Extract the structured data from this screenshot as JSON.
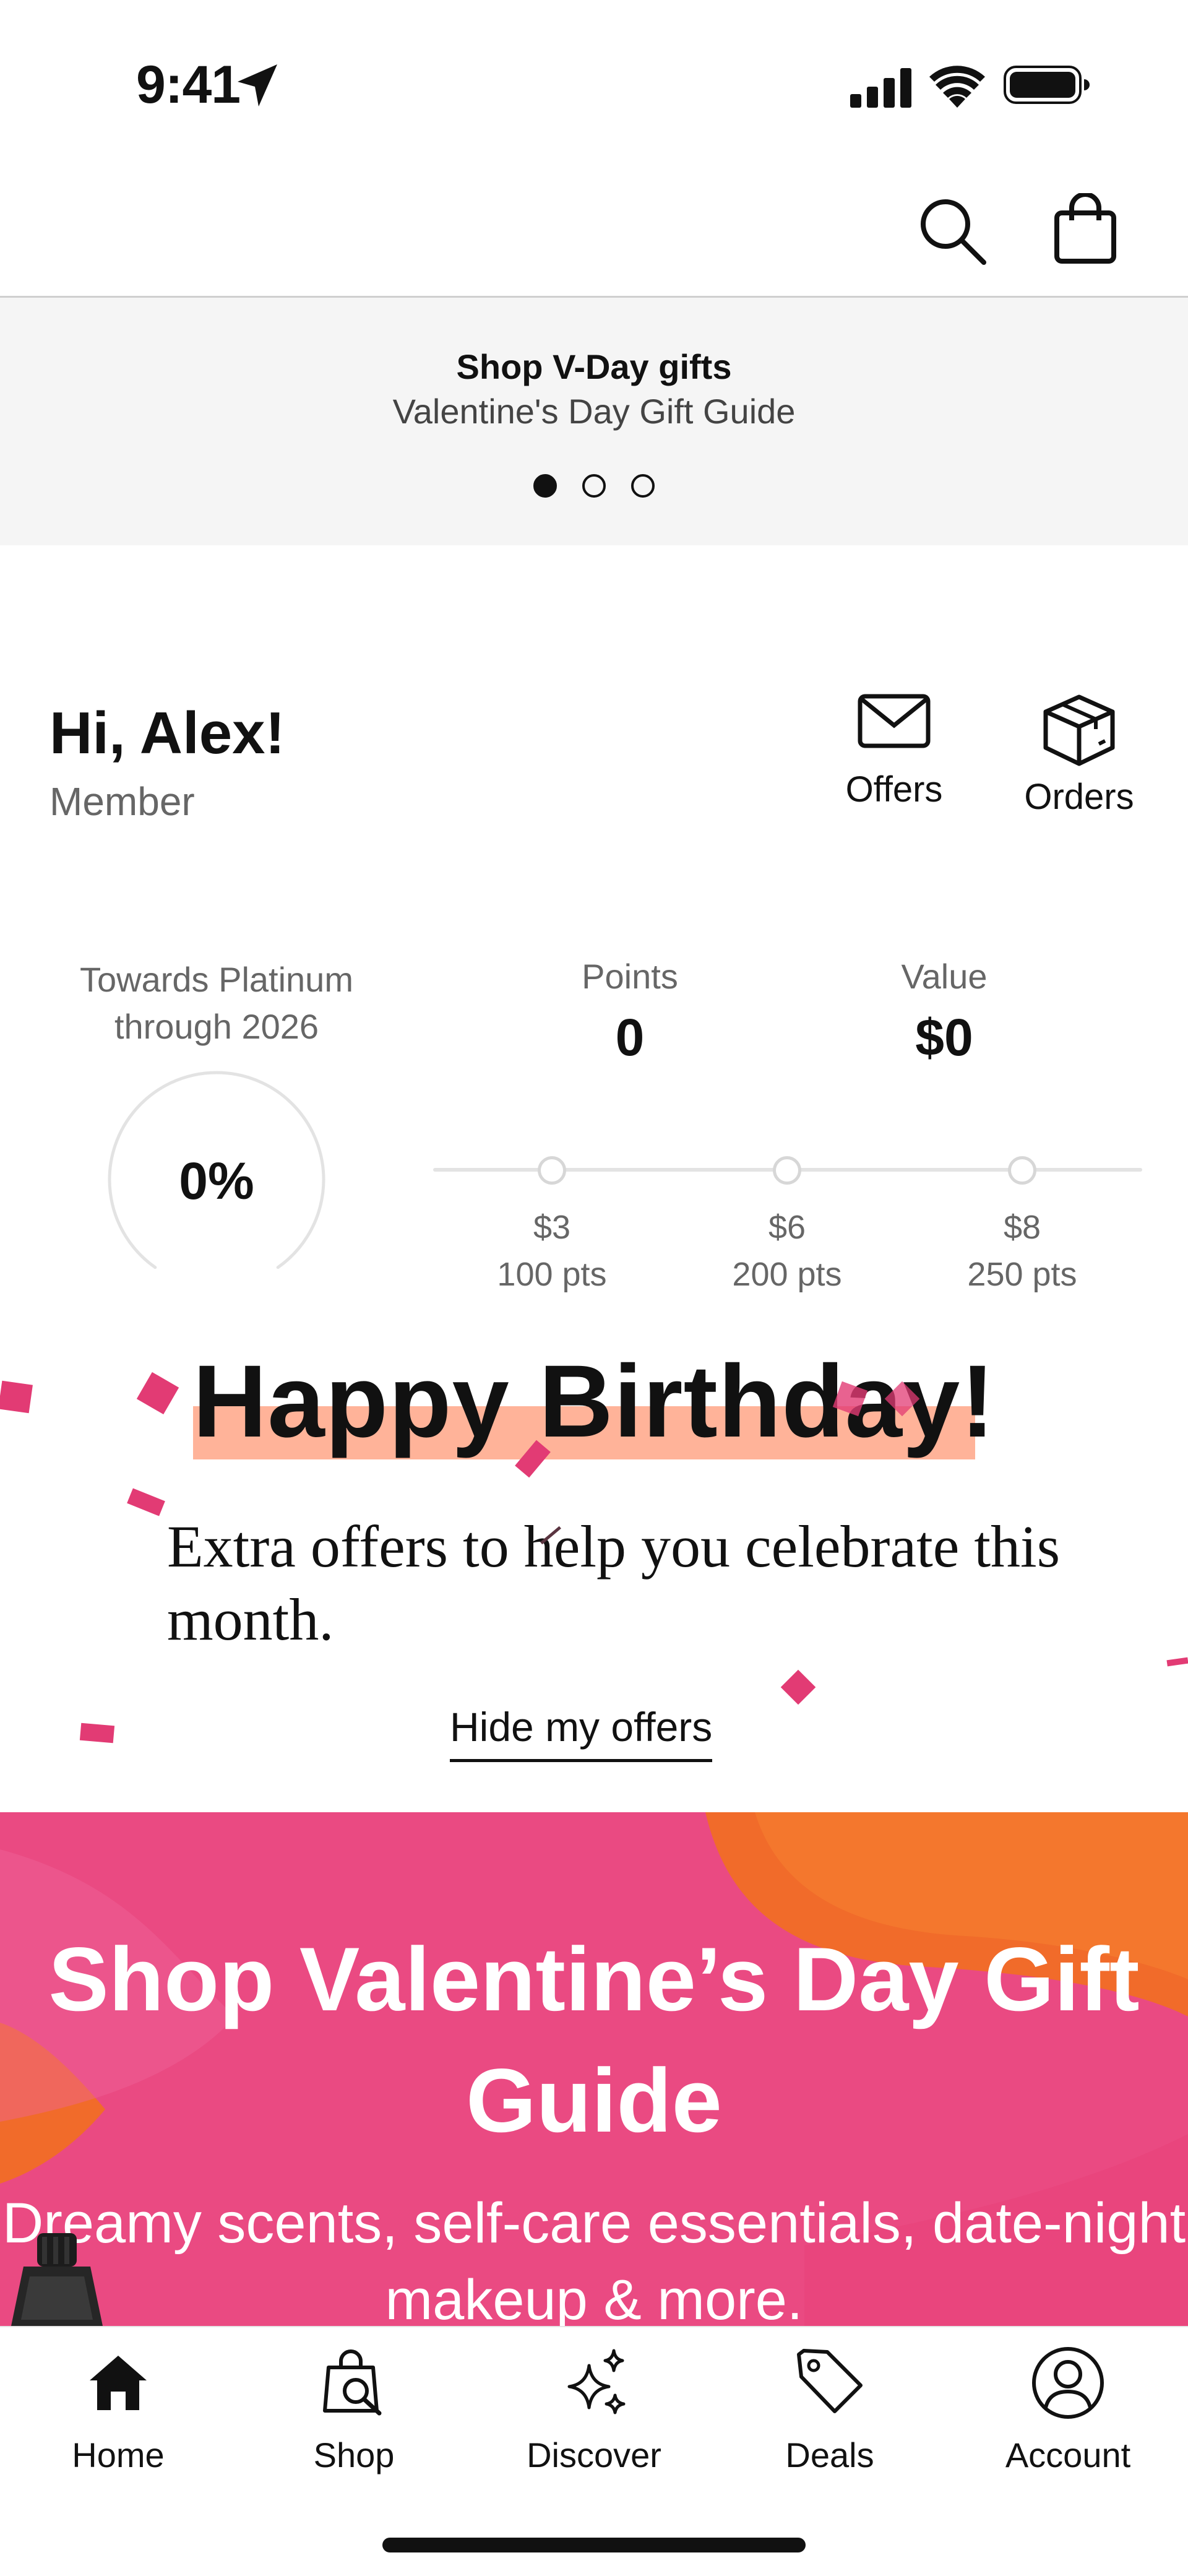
{
  "status_bar": {
    "time": "9:41"
  },
  "header": {
    "search_icon": "search-icon",
    "bag_icon": "shopping-bag-icon"
  },
  "promo": {
    "title": "Shop V-Day gifts",
    "subtitle": "Valentine's Day Gift Guide",
    "carousel": {
      "count": 3,
      "active_index": 0
    }
  },
  "user": {
    "greeting": "Hi, Alex!",
    "tier": "Member",
    "quick_actions": [
      {
        "label": "Offers",
        "icon": "envelope-icon"
      },
      {
        "label": "Orders",
        "icon": "box-icon"
      }
    ]
  },
  "progress": {
    "towards": "Towards Platinum through 2026",
    "percent_label": "0%",
    "percent_value": 0,
    "points_label": "Points",
    "points_value": "0",
    "value_label": "Value",
    "value_value": "$0",
    "rewards": [
      {
        "amount": "$3",
        "points": "100 pts"
      },
      {
        "amount": "$6",
        "points": "200 pts"
      },
      {
        "amount": "$8",
        "points": "250 pts"
      }
    ]
  },
  "birthday": {
    "title": "Happy Birthday!",
    "text": "Extra offers to help you celebrate this month.",
    "hide_link": "Hide my offers"
  },
  "banner": {
    "title": "Shop Valentine’s Day Gift Guide",
    "subtitle": "Dreamy scents, self-care essentials, date-night makeup & more."
  },
  "tab_bar": [
    {
      "label": "Home",
      "icon": "home-icon"
    },
    {
      "label": "Shop",
      "icon": "shop-bag-search-icon"
    },
    {
      "label": "Discover",
      "icon": "sparkles-icon"
    },
    {
      "label": "Deals",
      "icon": "tag-icon"
    },
    {
      "label": "Account",
      "icon": "user-circle-icon"
    }
  ],
  "colors": {
    "highlight": "#ffb399",
    "confetti": "#e23b74",
    "banner_pink": "#ea4a82",
    "banner_orange": "#f16b2a",
    "promo_bg": "#f5f5f5"
  }
}
